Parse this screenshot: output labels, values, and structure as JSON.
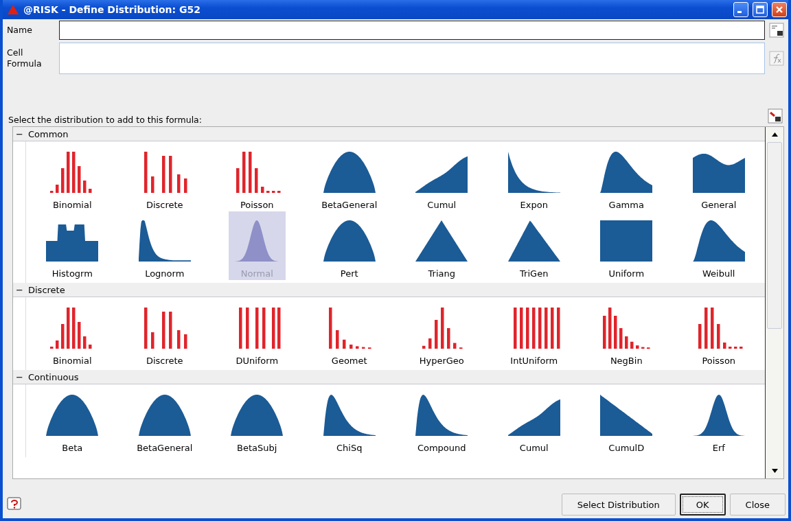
{
  "window": {
    "title": "@RISK - Define Distribution: G52"
  },
  "fields": [
    {
      "label": "Name"
    },
    {
      "label": "Cell Formula"
    }
  ],
  "prompt": "Select the distribution to add to this formula:",
  "sections": [
    {
      "title": "Common",
      "toggle": "−",
      "items": [
        {
          "label": "Binomial",
          "kind": "discrete",
          "selected": false
        },
        {
          "label": "Discrete",
          "kind": "discrete",
          "selected": false
        },
        {
          "label": "Poisson",
          "kind": "discrete",
          "selected": false
        },
        {
          "label": "BetaGeneral",
          "kind": "continuous",
          "selected": false
        },
        {
          "label": "Cumul",
          "kind": "continuous",
          "selected": false
        },
        {
          "label": "Expon",
          "kind": "continuous",
          "selected": false
        },
        {
          "label": "Gamma",
          "kind": "continuous",
          "selected": false
        },
        {
          "label": "General",
          "kind": "continuous",
          "selected": false
        },
        {
          "label": "Histogrm",
          "kind": "continuous",
          "selected": false
        },
        {
          "label": "Lognorm",
          "kind": "continuous",
          "selected": false
        },
        {
          "label": "Normal",
          "kind": "continuous",
          "selected": true
        },
        {
          "label": "Pert",
          "kind": "continuous",
          "selected": false
        },
        {
          "label": "Triang",
          "kind": "continuous",
          "selected": false
        },
        {
          "label": "TriGen",
          "kind": "continuous",
          "selected": false
        },
        {
          "label": "Uniform",
          "kind": "continuous",
          "selected": false
        },
        {
          "label": "Weibull",
          "kind": "continuous",
          "selected": false
        }
      ]
    },
    {
      "title": "Discrete",
      "toggle": "−",
      "items": [
        {
          "label": "Binomial",
          "kind": "discrete",
          "selected": false
        },
        {
          "label": "Discrete",
          "kind": "discrete",
          "selected": false
        },
        {
          "label": "DUniform",
          "kind": "discrete",
          "selected": false
        },
        {
          "label": "Geomet",
          "kind": "discrete",
          "selected": false
        },
        {
          "label": "HyperGeo",
          "kind": "discrete",
          "selected": false
        },
        {
          "label": "IntUniform",
          "kind": "discrete",
          "selected": false
        },
        {
          "label": "NegBin",
          "kind": "discrete",
          "selected": false
        },
        {
          "label": "Poisson",
          "kind": "discrete",
          "selected": false
        }
      ]
    },
    {
      "title": "Continuous",
      "toggle": "−",
      "items": [
        {
          "label": "Beta",
          "kind": "continuous",
          "selected": false
        },
        {
          "label": "BetaGeneral",
          "kind": "continuous",
          "selected": false
        },
        {
          "label": "BetaSubj",
          "kind": "continuous",
          "selected": false
        },
        {
          "label": "ChiSq",
          "kind": "continuous",
          "selected": false
        },
        {
          "label": "Compound",
          "kind": "continuous",
          "selected": false
        },
        {
          "label": "Cumul",
          "kind": "continuous",
          "selected": false
        },
        {
          "label": "CumulD",
          "kind": "continuous",
          "selected": false
        },
        {
          "label": "Erf",
          "kind": "continuous",
          "selected": false
        }
      ]
    }
  ],
  "buttons": [
    {
      "label": "Select Distribution",
      "default": false
    },
    {
      "label": "OK",
      "default": true
    },
    {
      "label": "Close",
      "default": false
    }
  ]
}
